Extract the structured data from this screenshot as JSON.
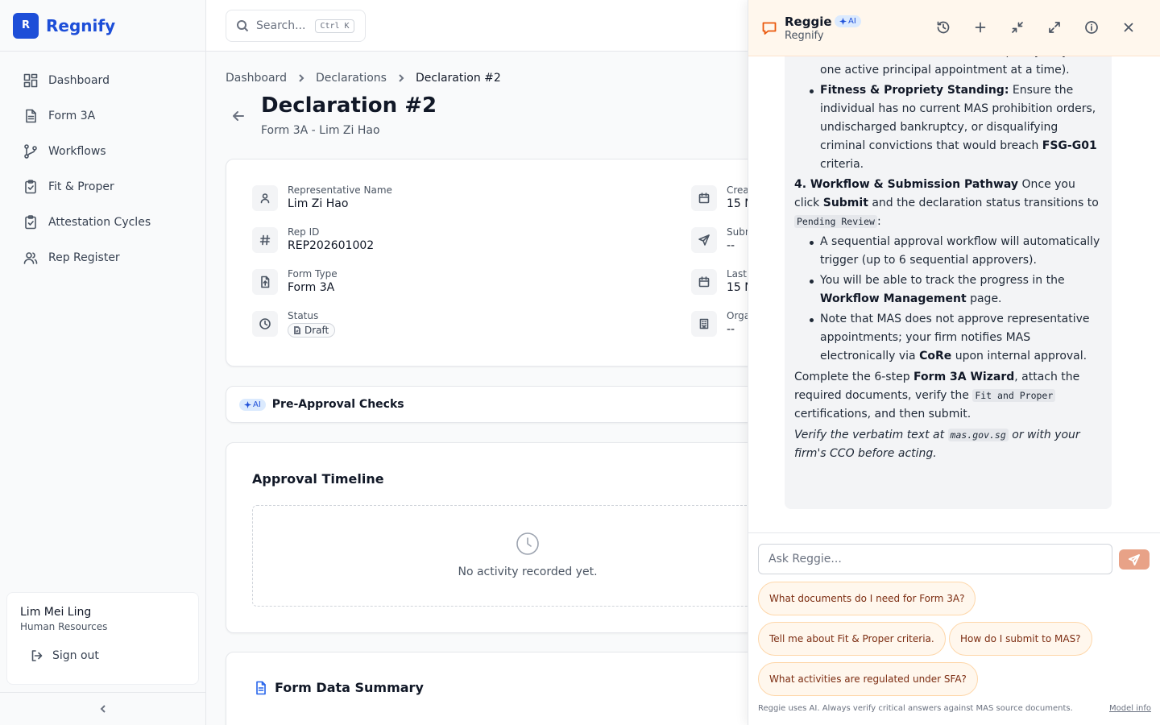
{
  "brand": {
    "logo_letter": "R",
    "name": "Regnify",
    "accent": "#1d4ed8"
  },
  "sidebar": {
    "items": [
      {
        "label": "Dashboard",
        "icon": "dashboard-icon"
      },
      {
        "label": "Form 3A",
        "icon": "document-icon"
      },
      {
        "label": "Workflows",
        "icon": "workflow-icon"
      },
      {
        "label": "Fit & Proper",
        "icon": "clipboard-check-icon"
      },
      {
        "label": "Attestation Cycles",
        "icon": "clipboard-check-icon"
      },
      {
        "label": "Rep Register",
        "icon": "users-icon"
      }
    ],
    "user": {
      "name": "Lim Mei Ling",
      "role": "Human Resources"
    },
    "signout_label": "Sign out"
  },
  "topbar": {
    "search_placeholder": "Search...",
    "shortcut": "Ctrl K"
  },
  "breadcrumb": [
    "Dashboard",
    "Declarations",
    "Declaration #2"
  ],
  "page": {
    "title": "Declaration #2",
    "subtitle": "Form 3A - Lim Zi Hao"
  },
  "details": {
    "left": [
      {
        "label": "Representative Name",
        "value": "Lim Zi Hao",
        "icon": "user-icon"
      },
      {
        "label": "Rep ID",
        "value": "REP202601002",
        "icon": "hash-icon"
      },
      {
        "label": "Form Type",
        "value": "Form 3A",
        "icon": "file-icon"
      },
      {
        "label": "Status",
        "value": "Draft",
        "icon": "clock-icon"
      }
    ],
    "right": [
      {
        "label": "Crea",
        "value": "15 N",
        "icon": "calendar-icon"
      },
      {
        "label": "Subr",
        "value": "--",
        "icon": "send-icon"
      },
      {
        "label": "Last",
        "value": "15 N",
        "icon": "calendar-icon"
      },
      {
        "label": "Orga",
        "value": "--",
        "icon": "building-icon"
      }
    ]
  },
  "pre_approval": {
    "ai_label": "AI",
    "title": "Pre-Approval Checks"
  },
  "timeline": {
    "title": "Approval Timeline",
    "empty_message": "No activity recorded yet."
  },
  "summary": {
    "title": "Form Data Summary"
  },
  "chat": {
    "title": "Reggie",
    "ai_label": "AI",
    "subtitle": "Regnify",
    "accent": "#ea580c",
    "message": {
      "b1_line1": "representative is not already appointed by another financial institution (a rep may only hold one active principal appointment at a time).",
      "b2_bold": "Fitness & Propriety Standing:",
      "b2_text": " Ensure the individual has no current MAS prohibition orders, undischarged bankruptcy, or disqualifying criminal convictions that would breach ",
      "b2_bold2": "FSG-G01",
      "b2_text2": " criteria.",
      "s4_bold": "4. Workflow & Submission Pathway",
      "s4_text1": " Once you click ",
      "s4_bold2": "Submit",
      "s4_text2": " and the declaration status transitions to ",
      "s4_code": "Pending Review",
      "s4_text3": ":",
      "b3": "A sequential approval workflow will automatically trigger (up to 6 sequential approvers).",
      "b4_text": "You will be able to track the progress in the ",
      "b4_bold": "Workflow Management",
      "b4_text2": " page.",
      "b5_text": "Note that MAS does not approve representative appointments; your firm notifies MAS electronically via ",
      "b5_bold": "CoRe",
      "b5_text2": " upon internal approval.",
      "p1_text": "Complete the 6-step ",
      "p1_bold": "Form 3A Wizard",
      "p1_text2": ", attach the required documents, verify the ",
      "p1_code": "Fit and Proper",
      "p1_text3": " certifications, and then submit.",
      "p2_text": "Verify the verbatim text at ",
      "p2_code": "mas.gov.sg",
      "p2_text2": " or with your firm's CCO before acting."
    },
    "input_placeholder": "Ask Reggie...",
    "suggestions": [
      "What documents do I need for Form 3A?",
      "Tell me about Fit & Proper criteria.",
      "How do I submit to MAS?",
      "What activities are regulated under SFA?"
    ],
    "disclaimer": "Reggie uses AI. Always verify critical answers against MAS source documents.",
    "model_info": "Model info"
  }
}
